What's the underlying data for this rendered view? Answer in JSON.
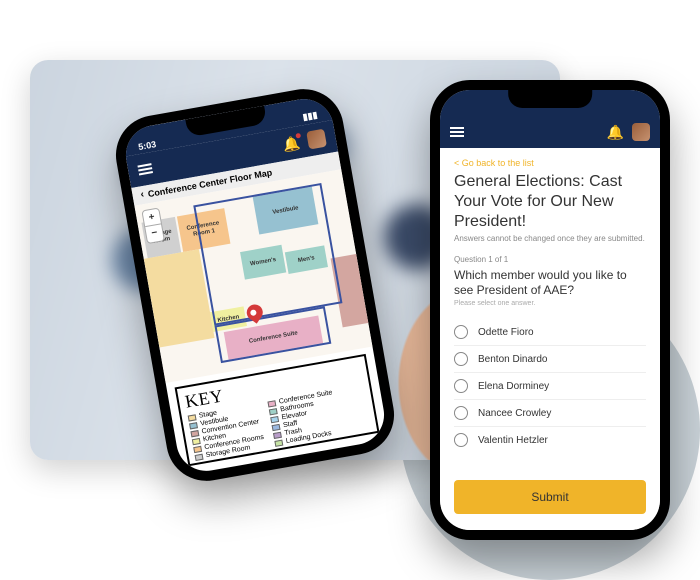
{
  "left_phone": {
    "statusbar": {
      "time": "5:03"
    },
    "map_title": "Conference Center Floor Map",
    "zoom": {
      "in": "+",
      "out": "−"
    },
    "rooms": {
      "storage": "Storage Room",
      "conf1": "Conference Room 1",
      "vestibule": "Vestibule",
      "womens": "Women's",
      "mens": "Men's",
      "kitchen": "Kitchen",
      "conf_suite": "Conference Suite"
    },
    "key_title": "KEY",
    "legend_col1": [
      {
        "label": "Stage",
        "color": "#f4dca0"
      },
      {
        "label": "Vestibule",
        "color": "#96c1d1"
      },
      {
        "label": "Convention Center",
        "color": "#d3a6a0"
      },
      {
        "label": "Kitchen",
        "color": "#f0f0a0"
      },
      {
        "label": "Conference Rooms",
        "color": "#f6c58c"
      },
      {
        "label": "Storage Room",
        "color": "#cccccc"
      }
    ],
    "legend_col2": [
      {
        "label": "Conference Suite",
        "color": "#e8b0c6"
      },
      {
        "label": "Bathrooms",
        "color": "#9fd1c8"
      },
      {
        "label": "Elevator",
        "color": "#a6d4ed"
      },
      {
        "label": "Staff",
        "color": "#9ab8e0"
      },
      {
        "label": "Trash",
        "color": "#b89cc9"
      },
      {
        "label": "Loading Docks",
        "color": "#c6e4a5"
      }
    ]
  },
  "right_phone": {
    "back_label": "< Go back to the list",
    "title": "General Elections: Cast Your Vote for Our New President!",
    "subtitle": "Answers cannot be changed once they are submitted.",
    "question_meta": "Question 1 of 1",
    "question": "Which member would you like to see President of AAE?",
    "hint": "Please select one answer.",
    "options": [
      "Odette Fioro",
      "Benton Dinardo",
      "Elena Dorminey",
      "Nancee Crowley",
      "Valentin Hetzler"
    ],
    "submit_label": "Submit"
  }
}
